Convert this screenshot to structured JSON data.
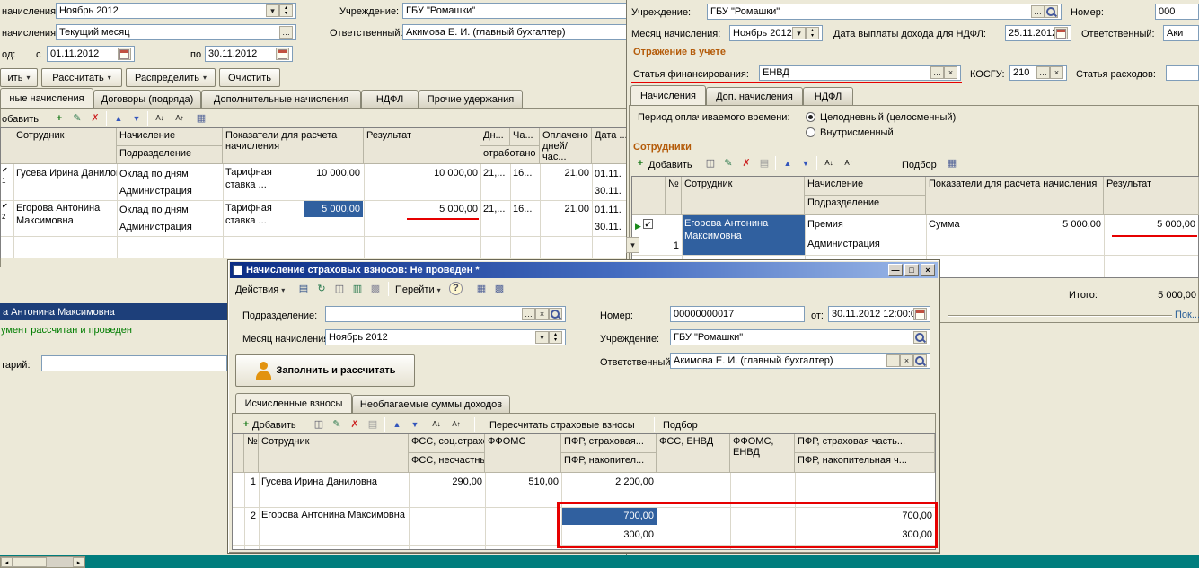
{
  "icons": {
    "dropdown": "▾",
    "spin_up": "▴",
    "spin_down": "▾",
    "ellipsis": "…",
    "clear": "×",
    "add": "+",
    "edit": "✎",
    "delete": "✗",
    "copy": "◫",
    "save": "▤",
    "sheet": "▥",
    "move_up": "▲",
    "move_down": "▼",
    "sort_asc": "А↓",
    "sort_desc": "А↑",
    "grid": "▦",
    "settings": "▩",
    "refresh": "↻",
    "help": "?",
    "check": "✔",
    "row_arrow": "▶",
    "left": "◂",
    "right": "▸",
    "minimize": "—",
    "maximize": "□",
    "close": "×"
  },
  "left_window": {
    "rows": {
      "month_label": "начисления:",
      "month_value": "Ноябрь 2012",
      "institution_label": "Учреждение:",
      "institution_value": "ГБУ \"Ромашки\"",
      "accrual_label": "начисления:",
      "accrual_value": "Текущий месяц",
      "responsible_label": "Ответственный:",
      "responsible_value": "Акимова Е. И. (главный бухгалтер)",
      "period_label": "од:",
      "date_from_label": "с",
      "date_from": "01.11.2012",
      "date_to_label": "по",
      "date_to": "30.11.2012"
    },
    "buttons": {
      "fill": "ить",
      "calculate": "Рассчитать",
      "distribute": "Распределить",
      "clear": "Очистить"
    },
    "tabs": [
      "ные начисления",
      "Договоры (подряда)",
      "Дополнительные начисления",
      "НДФЛ",
      "Прочие удержания"
    ],
    "toolbar": {
      "add": "обавить"
    },
    "grid": {
      "headers": {
        "employee": "Сотрудник",
        "accrual": "Начисление",
        "department": "Подразделение",
        "indicators": "Показатели для расчета начисления",
        "result": "Результат",
        "days": "Дн...",
        "hours": "Ча...",
        "worked": "отработано",
        "paid": "Оплачено дней/час...",
        "date": "Дата ..."
      },
      "rows": [
        {
          "num": "1",
          "check": "✔",
          "name": "Гусева Ирина Даниловна",
          "accrual": "Оклад по дням",
          "department": "Администрация",
          "indicator": "Тарифная ставка ...",
          "indicator_value": "10 000,00",
          "result": "10 000,00",
          "days": "21,...",
          "hours": "16...",
          "paid": "21,00",
          "date_start": "01.11.",
          "date_end": "30.11."
        },
        {
          "num": "2",
          "check": "✔",
          "name": "Егорова Антонина Максимовна",
          "accrual": "Оклад по дням",
          "department": "Администрация",
          "indicator": "Тарифная ставка ...",
          "indicator_value": "5 000,00",
          "result": "5 000,00",
          "days": "21,...",
          "hours": "16...",
          "paid": "21,00",
          "date_start": "01.11.",
          "date_end": "30.11."
        }
      ]
    },
    "selection_text": "а Антонина Максимовна",
    "status_text": "умент рассчитан и проведен",
    "comment_label": "тарий:"
  },
  "right_window": {
    "fields": {
      "institution_label": "Учреждение:",
      "institution_value": "ГБУ \"Ромашки\"",
      "number_label": "Номер:",
      "number_value": "000",
      "month_label": "Месяц начисления:",
      "month_value": "Ноябрь 2012",
      "ndfl_date_label": "Дата выплаты дохода для НДФЛ:",
      "ndfl_date_value": "25.11.2012",
      "responsible_label": "Ответственный:",
      "responsible_value": "Аки",
      "finance_label": "Статья финансирования:",
      "finance_value": "ЕНВД",
      "kosgu_label": "КОСГУ:",
      "kosgu_value": "210",
      "expense_label": "Статья расходов:"
    },
    "section_accounting": "Отражение в учете",
    "tabs": [
      "Начисления",
      "Доп. начисления",
      "НДФЛ"
    ],
    "period_label": "Период оплачиваемого времени:",
    "radio_fullday": "Целодневный (целосменный)",
    "radio_intrashift": "Внутрисменный",
    "section_employees": "Сотрудники",
    "toolbar": {
      "add": "Добавить",
      "pick": "Подбор"
    },
    "grid": {
      "headers": {
        "num": "№",
        "employee": "Сотрудник",
        "accrual": "Начисление",
        "department": "Подразделение",
        "indicators": "Показатели для расчета начисления",
        "result": "Результат"
      },
      "row": {
        "num": "1",
        "name": "Егорова Антонина Максимовна",
        "accrual": "Премия",
        "department": "Администрация",
        "indicator": "Сумма",
        "indicator_value": "5 000,00",
        "result": "5 000,00"
      }
    },
    "total_label": "Итого:",
    "total_value": "5 000,00",
    "link_more": "Пок..."
  },
  "front_window": {
    "title": "Начисление страховых взносов: Не проведен *",
    "menu": {
      "actions": "Действия",
      "goto": "Перейти"
    },
    "fields": {
      "department_label": "Подразделение:",
      "number_label": "Номер:",
      "number_value": "00000000017",
      "date_label": "от:",
      "date_value": "30.11.2012 12:00:00",
      "month_label": "Месяц начисления:",
      "month_value": "Ноябрь 2012",
      "institution_label": "Учреждение:",
      "institution_value": "ГБУ \"Ромашки\"",
      "responsible_label": "Ответственный:",
      "responsible_value": "Акимова Е. И. (главный бухгалтер)"
    },
    "fill_button": "Заполнить и рассчитать",
    "tabs": [
      "Исчисленные взносы",
      "Необлагаемые суммы доходов"
    ],
    "toolbar": {
      "add": "Добавить",
      "recalc": "Пересчитать страховые взносы",
      "pick": "Подбор"
    },
    "grid": {
      "headers": {
        "num": "№",
        "employee": "Сотрудник",
        "fss_social": "ФСС, соц.страхо...",
        "fss_accident": "ФСС, несчастны...",
        "ffoms": "ФФОМС",
        "pfr_insurance": "ПФР, страховая...",
        "pfr_savings": "ПФР, накопител...",
        "fss_envd": "ФСС, ЕНВД",
        "ffoms_envd": "ФФОМС, ЕНВД",
        "pfr_insurance_part": "ПФР, страховая часть...",
        "pfr_savings_part": "ПФР, накопительная ч..."
      },
      "rows": [
        {
          "num": "1",
          "name": "Гусева Ирина Даниловна",
          "fss_social": "290,00",
          "ffoms": "510,00",
          "pfr_insurance": "2 200,00",
          "pfr_savings": "",
          "pfr_insurance_part": "",
          "pfr_savings_part": ""
        },
        {
          "num": "2",
          "name": "Егорова Антонина Максимовна",
          "fss_social": "",
          "ffoms": "",
          "pfr_insurance": "700,00",
          "pfr_savings": "300,00",
          "pfr_insurance_part": "700,00",
          "pfr_savings_part": "300,00"
        }
      ]
    }
  }
}
